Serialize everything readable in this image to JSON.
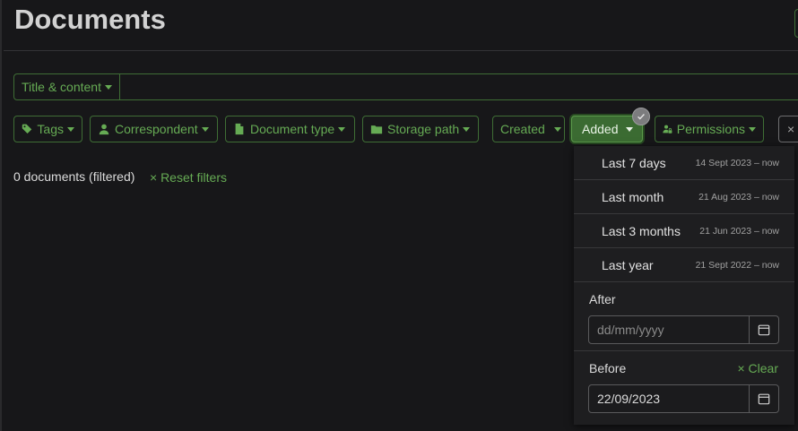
{
  "page": {
    "title": "Documents"
  },
  "text_filter": {
    "mode_label": "Title & content",
    "value": ""
  },
  "filters": {
    "tags": "Tags",
    "correspondent": "Correspondent",
    "document_type": "Document type",
    "storage_path": "Storage path",
    "created": "Created",
    "added": "Added",
    "permissions": "Permissions"
  },
  "results": {
    "count_text": "0 documents (filtered)",
    "reset_label": "× Reset filters"
  },
  "date_menu": {
    "quick_ranges": [
      {
        "label": "Last 7 days",
        "range": "14 Sept 2023 – now"
      },
      {
        "label": "Last month",
        "range": "21 Aug 2023 – now"
      },
      {
        "label": "Last 3 months",
        "range": "21 Jun 2023 – now"
      },
      {
        "label": "Last year",
        "range": "21 Sept 2022 – now"
      }
    ],
    "after": {
      "label": "After",
      "placeholder": "dd/mm/yyyy",
      "value": ""
    },
    "before": {
      "label": "Before",
      "clear_label": "× Clear",
      "value": "22/09/2023"
    }
  },
  "colors": {
    "accent": "#66ab54",
    "accent_border": "#3f6e35",
    "background": "#171719",
    "menu": "#1e1e20"
  }
}
